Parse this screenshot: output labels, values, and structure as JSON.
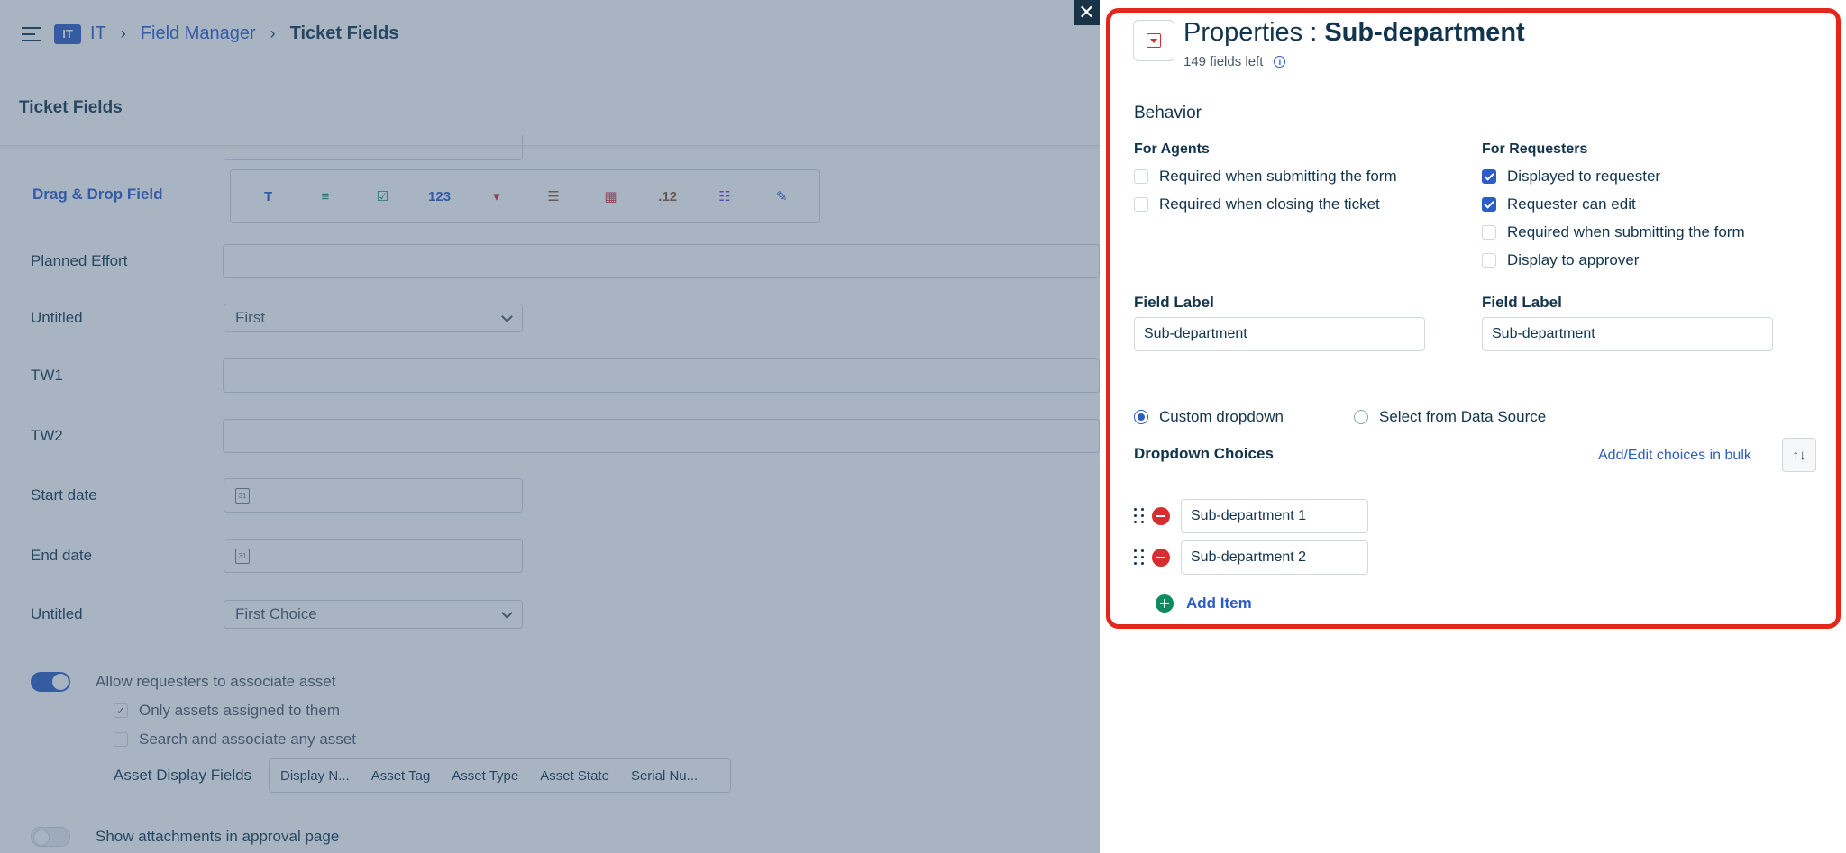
{
  "breadcrumb": {
    "workspace_badge": "IT",
    "workspace": "IT",
    "field_manager": "Field Manager",
    "current": "Ticket Fields",
    "separator": "›"
  },
  "subheader": {
    "title": "Ticket Fields"
  },
  "form": {
    "drag_drop_label": "Drag & Drop Field",
    "field_types": [
      {
        "icon": "text-field-icon",
        "glyph": "T",
        "color": "#2c5cc5"
      },
      {
        "icon": "paragraph-field-icon",
        "glyph": "≡",
        "color": "#0e8a5f"
      },
      {
        "icon": "checkbox-field-icon",
        "glyph": "☑",
        "color": "#0e8a5f"
      },
      {
        "icon": "number-field-icon",
        "glyph": "123",
        "color": "#2c5cc5"
      },
      {
        "icon": "dropdown-field-icon",
        "glyph": "▾",
        "color": "#d72d30"
      },
      {
        "icon": "multi-line-field-icon",
        "glyph": "☰",
        "color": "#8a5a2b"
      },
      {
        "icon": "date-field-icon",
        "glyph": "▦",
        "color": "#d72d30"
      },
      {
        "icon": "decimal-field-icon",
        "glyph": ".12",
        "color": "#8a5a2b"
      },
      {
        "icon": "nested-field-icon",
        "glyph": "☷",
        "color": "#7c3aed"
      },
      {
        "icon": "edit-field-icon",
        "glyph": "✎",
        "color": "#2c5cc5"
      }
    ],
    "rows": {
      "planned_effort": {
        "label": "Planned Effort"
      },
      "untitled1": {
        "label": "Untitled",
        "value": "First"
      },
      "tw1": {
        "label": "TW1"
      },
      "tw2": {
        "label": "TW2"
      },
      "start_date": {
        "label": "Start date"
      },
      "end_date": {
        "label": "End date"
      },
      "untitled2": {
        "label": "Untitled",
        "value": "First Choice"
      }
    },
    "cal_glyph": "31",
    "asset": {
      "allow_label": "Allow requesters to associate asset",
      "only_assigned": "Only assets assigned to them",
      "search_any": "Search and associate any asset",
      "display_fields_label": "Asset Display Fields",
      "display_fields": [
        "Display N...",
        "Asset Tag",
        "Asset Type",
        "Asset State",
        "Serial Nu..."
      ],
      "check_glyph": "✓"
    },
    "show_attachments": "Show attachments in approval page"
  },
  "close_glyph": "✕",
  "properties": {
    "title_prefix": "Properties : ",
    "field_name": "Sub-department",
    "fields_left": "149 fields left",
    "info_glyph": "i",
    "behavior": "Behavior",
    "for_agents": {
      "heading": "For Agents",
      "options": [
        {
          "label": "Required when submitting the form",
          "checked": false
        },
        {
          "label": "Required when closing the ticket",
          "checked": false
        }
      ]
    },
    "for_requesters": {
      "heading": "For Requesters",
      "options": [
        {
          "label": "Displayed to requester",
          "checked": true
        },
        {
          "label": "Requester can edit",
          "checked": true
        },
        {
          "label": "Required when submitting the form",
          "checked": false
        },
        {
          "label": "Display to approver",
          "checked": false
        }
      ]
    },
    "agent_field_label": {
      "label": "Field Label",
      "value": "Sub-department"
    },
    "requester_field_label": {
      "label": "Field Label",
      "value": "Sub-department"
    },
    "source": {
      "custom": "Custom dropdown",
      "data_source": "Select from Data Source",
      "selected": "custom"
    },
    "dropdown_choices_label": "Dropdown Choices",
    "bulk_edit": "Add/Edit choices in bulk",
    "sort_glyph": "↑↓",
    "choices": [
      "Sub-department 1",
      "Sub-department 2"
    ],
    "add_item": "Add Item"
  }
}
